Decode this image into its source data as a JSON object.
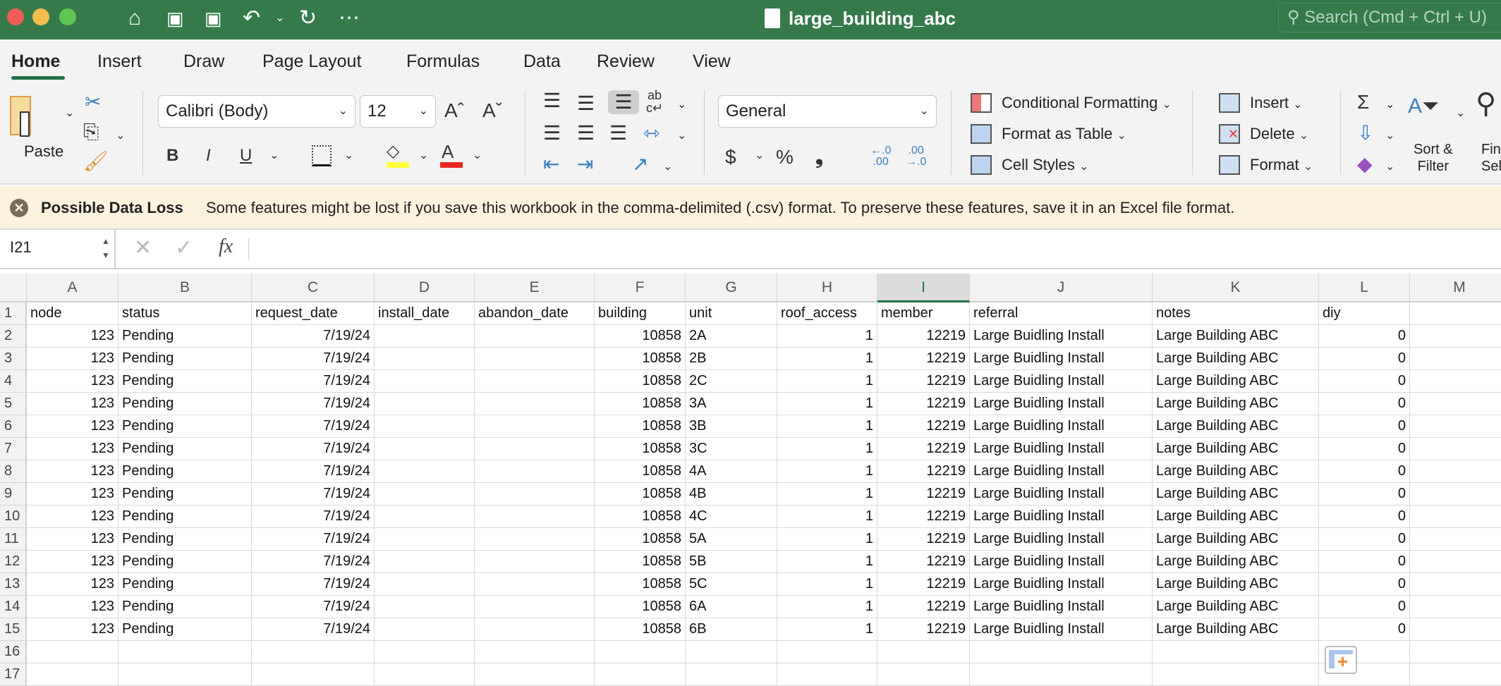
{
  "window": {
    "title": "large_building_abc",
    "search_placeholder": "Search (Cmd + Ctrl + U)",
    "file_icon": "excel-file-icon"
  },
  "toolbar_icons": [
    "home-icon",
    "save-icon",
    "save-as-icon",
    "undo-icon",
    "redo-icon",
    "more-icon"
  ],
  "tabs": [
    {
      "label": "Home",
      "active": true
    },
    {
      "label": "Insert"
    },
    {
      "label": "Draw"
    },
    {
      "label": "Page Layout"
    },
    {
      "label": "Formulas"
    },
    {
      "label": "Data"
    },
    {
      "label": "Review"
    },
    {
      "label": "View"
    }
  ],
  "ribbon": {
    "paste": "Paste",
    "font_name": "Calibri (Body)",
    "font_size": "12",
    "number_format": "General",
    "conditional_formatting": "Conditional Formatting",
    "format_as_table": "Format as Table",
    "cell_styles": "Cell Styles",
    "insert": "Insert",
    "delete": "Delete",
    "format": "Format",
    "sort_filter_1": "Sort &",
    "sort_filter_2": "Filter",
    "find_1": "Find &",
    "find_2": "Select",
    "bold": "B",
    "italic": "I",
    "underline": "U",
    "currency": "$",
    "percent": "%",
    "comma": "❟",
    "colors": {
      "highlight": "#ffff3b",
      "font": "#e8281e",
      "accent": "#1e7145"
    }
  },
  "banner": {
    "title": "Possible Data Loss",
    "message": "Some features might be lost if you save this workbook in the comma-delimited (.csv) format. To preserve these features, save it in an Excel file format."
  },
  "formula_bar": {
    "name_box": "I21",
    "formula": ""
  },
  "sheet": {
    "selected_column": "I",
    "columns": [
      "A",
      "B",
      "C",
      "D",
      "E",
      "F",
      "G",
      "H",
      "I",
      "J",
      "K",
      "L",
      "M"
    ],
    "row_numbers": [
      "1",
      "2",
      "3",
      "4",
      "5",
      "6",
      "7",
      "8",
      "9",
      "10",
      "11",
      "12",
      "13",
      "14",
      "15",
      "16",
      "17"
    ],
    "headers": [
      "node",
      "status",
      "request_date",
      "install_date",
      "abandon_date",
      "building",
      "unit",
      "roof_access",
      "member",
      "referral",
      "notes",
      "diy",
      ""
    ],
    "rows": [
      [
        "123",
        "Pending",
        "7/19/24",
        "",
        "",
        "10858",
        "2A",
        "1",
        "12219",
        "Large Buidling Install",
        "Large Building ABC",
        "0",
        ""
      ],
      [
        "123",
        "Pending",
        "7/19/24",
        "",
        "",
        "10858",
        "2B",
        "1",
        "12219",
        "Large Buidling Install",
        "Large Building ABC",
        "0",
        ""
      ],
      [
        "123",
        "Pending",
        "7/19/24",
        "",
        "",
        "10858",
        "2C",
        "1",
        "12219",
        "Large Buidling Install",
        "Large Building ABC",
        "0",
        ""
      ],
      [
        "123",
        "Pending",
        "7/19/24",
        "",
        "",
        "10858",
        "3A",
        "1",
        "12219",
        "Large Buidling Install",
        "Large Building ABC",
        "0",
        ""
      ],
      [
        "123",
        "Pending",
        "7/19/24",
        "",
        "",
        "10858",
        "3B",
        "1",
        "12219",
        "Large Buidling Install",
        "Large Building ABC",
        "0",
        ""
      ],
      [
        "123",
        "Pending",
        "7/19/24",
        "",
        "",
        "10858",
        "3C",
        "1",
        "12219",
        "Large Buidling Install",
        "Large Building ABC",
        "0",
        ""
      ],
      [
        "123",
        "Pending",
        "7/19/24",
        "",
        "",
        "10858",
        "4A",
        "1",
        "12219",
        "Large Buidling Install",
        "Large Building ABC",
        "0",
        ""
      ],
      [
        "123",
        "Pending",
        "7/19/24",
        "",
        "",
        "10858",
        "4B",
        "1",
        "12219",
        "Large Buidling Install",
        "Large Building ABC",
        "0",
        ""
      ],
      [
        "123",
        "Pending",
        "7/19/24",
        "",
        "",
        "10858",
        "4C",
        "1",
        "12219",
        "Large Buidling Install",
        "Large Building ABC",
        "0",
        ""
      ],
      [
        "123",
        "Pending",
        "7/19/24",
        "",
        "",
        "10858",
        "5A",
        "1",
        "12219",
        "Large Buidling Install",
        "Large Building ABC",
        "0",
        ""
      ],
      [
        "123",
        "Pending",
        "7/19/24",
        "",
        "",
        "10858",
        "5B",
        "1",
        "12219",
        "Large Buidling Install",
        "Large Building ABC",
        "0",
        ""
      ],
      [
        "123",
        "Pending",
        "7/19/24",
        "",
        "",
        "10858",
        "5C",
        "1",
        "12219",
        "Large Buidling Install",
        "Large Building ABC",
        "0",
        ""
      ],
      [
        "123",
        "Pending",
        "7/19/24",
        "",
        "",
        "10858",
        "6A",
        "1",
        "12219",
        "Large Buidling Install",
        "Large Building ABC",
        "0",
        ""
      ],
      [
        "123",
        "Pending",
        "7/19/24",
        "",
        "",
        "10858",
        "6B",
        "1",
        "12219",
        "Large Buidling Install",
        "Large Building ABC",
        "0",
        ""
      ],
      [
        "",
        "",
        "",
        "",
        "",
        "",
        "",
        "",
        "",
        "",
        "",
        "",
        ""
      ],
      [
        "",
        "",
        "",
        "",
        "",
        "",
        "",
        "",
        "",
        "",
        "",
        "",
        ""
      ]
    ]
  }
}
